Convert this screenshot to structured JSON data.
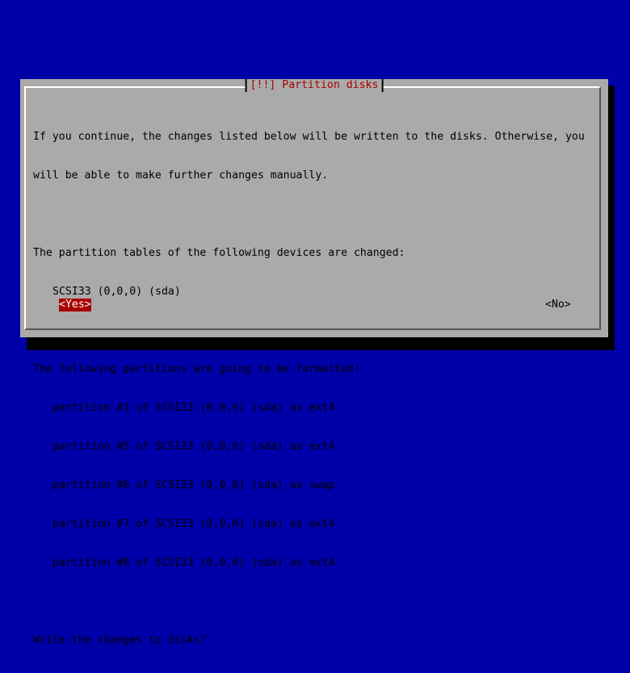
{
  "dialog": {
    "title": "[!!] Partition disks",
    "intro_line1": "If you continue, the changes listed below will be written to the disks. Otherwise, you",
    "intro_line2": "will be able to make further changes manually.",
    "tables_heading": "The partition tables of the following devices are changed:",
    "devices": [
      "SCSI33 (0,0,0) (sda)"
    ],
    "format_heading": "The following partitions are going to be formatted:",
    "partitions": [
      "partition #1 of SCSI33 (0,0,0) (sda) as ext4",
      "partition #5 of SCSI33 (0,0,0) (sda) as ext4",
      "partition #6 of SCSI33 (0,0,0) (sda) as swap",
      "partition #7 of SCSI33 (0,0,0) (sda) as ext4",
      "partition #8 of SCSI33 (0,0,0) (sda) as ext4"
    ],
    "question": "Write the changes to disks?",
    "yes_label": "<Yes>",
    "no_label": "<No>"
  },
  "colors": {
    "screen_background": "#0000a8",
    "dialog_background": "#aaaaaa",
    "title_color": "#a80000",
    "selected_button_background": "#a80000",
    "selected_button_text": "#ffffff"
  }
}
